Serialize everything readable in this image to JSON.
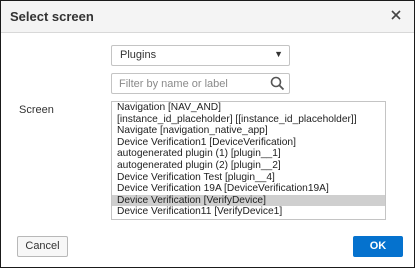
{
  "dialog": {
    "title": "Select screen",
    "close_icon": "close-icon"
  },
  "filter": {
    "selected": "Plugins",
    "arrow_icon": "caret-down-icon"
  },
  "search": {
    "placeholder": "Filter by name or label",
    "value": "",
    "icon": "search-icon"
  },
  "screen": {
    "label": "Screen",
    "items": [
      "Navigation [NAV_AND]",
      "[instance_id_placeholder] [[instance_id_placeholder]]",
      "Navigate [navigation_native_app]",
      "Device Verification1 [DeviceVerification]",
      "autogenerated plugin (1) [plugin__1]",
      "autogenerated plugin (2) [plugin__2]",
      "Device Verification Test [plugin__4]",
      "Device Verification 19A [DeviceVerification19A]",
      "Device Verification [VerifyDevice]",
      "Device Verification11 [VerifyDevice1]"
    ],
    "selected_index": 8,
    "selected_bg": "#cfcfcf"
  },
  "footer": {
    "cancel_label": "Cancel",
    "ok_label": "OK"
  },
  "colors": {
    "accent": "#0572ce"
  }
}
